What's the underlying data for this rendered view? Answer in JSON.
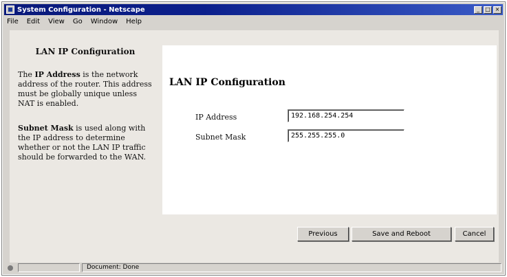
{
  "window": {
    "title": "System Configuration - Netscape"
  },
  "menu": [
    "File",
    "Edit",
    "View",
    "Go",
    "Window",
    "Help"
  ],
  "sidebar": {
    "title": "LAN IP Configuration",
    "para1_bold": "IP Address",
    "para1_pre": "The ",
    "para1_rest": " is the network address of the router. This address must be globally unique unless NAT is enabled.",
    "para2_bold": "Subnet Mask",
    "para2_rest": " is used along with the IP address to determine whether or not the LAN IP traffic should be forwarded to the WAN."
  },
  "main": {
    "title": "LAN IP Configuration",
    "ip_label": "IP Address",
    "ip_value": "192.168.254.254",
    "mask_label": "Subnet Mask",
    "mask_value": "255.255.255.0"
  },
  "buttons": {
    "previous": "Previous",
    "save": "Save and Reboot",
    "cancel": "Cancel"
  },
  "status": {
    "text": "Document: Done"
  }
}
